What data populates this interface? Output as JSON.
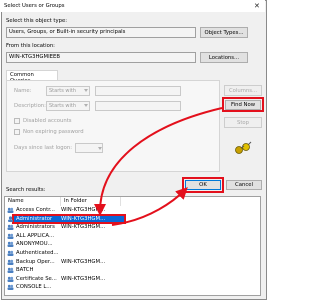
{
  "window": {
    "title": "Select Users or Groups",
    "close_glyph": "✕"
  },
  "object_type": {
    "label": "Select this object type:",
    "value": "Users, Groups, or Built-in security principals",
    "button": "Object Types..."
  },
  "location": {
    "label": "From this location:",
    "value": "WIN-KTG3HGMIEEB",
    "button": "Locations..."
  },
  "tab": {
    "label": "Common Queries"
  },
  "query": {
    "name_label": "Name:",
    "name_mode": "Starts with",
    "description_label": "Description:",
    "description_mode": "Starts with",
    "disabled_accounts": "Disabled accounts",
    "non_expiring": "Non expiring password",
    "days_label": "Days since last logon:"
  },
  "buttons": {
    "columns": "Columns...",
    "find_now": "Find Now",
    "stop": "Stop",
    "ok": "OK",
    "cancel": "Cancel"
  },
  "results": {
    "label": "Search results:",
    "columns": [
      "Name",
      "In Folder"
    ],
    "rows": [
      {
        "name": "Access Contr...",
        "folder": "WIN-KTG3HGM...",
        "icon": "group-icon"
      },
      {
        "name": "Administrator",
        "folder": "WIN-KTG3HGM...",
        "icon": "user-icon",
        "selected": true
      },
      {
        "name": "Administrators",
        "folder": "WIN-KTG3HGM...",
        "icon": "group-icon"
      },
      {
        "name": "ALL APPLICA...",
        "folder": "",
        "icon": "group-icon"
      },
      {
        "name": "ANONYMOU...",
        "folder": "",
        "icon": "group-icon"
      },
      {
        "name": "Authenticated...",
        "folder": "",
        "icon": "group-icon"
      },
      {
        "name": "Backup Oper...",
        "folder": "WIN-KTG3HGM...",
        "icon": "group-icon"
      },
      {
        "name": "BATCH",
        "folder": "",
        "icon": "group-icon"
      },
      {
        "name": "Certificate Se...",
        "folder": "WIN-KTG3HGM...",
        "icon": "group-icon"
      },
      {
        "name": "CONSOLE L...",
        "folder": "",
        "icon": "group-icon"
      }
    ]
  },
  "colors": {
    "highlight": "#e3101c",
    "selection": "#0a67d6"
  }
}
